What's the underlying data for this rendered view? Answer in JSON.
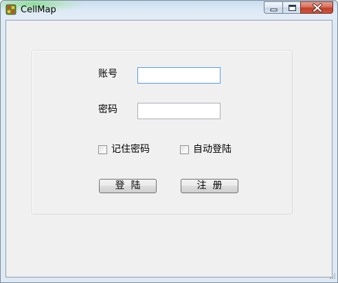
{
  "window": {
    "title": "CellMap"
  },
  "form": {
    "account_label": "账号",
    "account_value": "",
    "password_label": "密码",
    "password_value": "",
    "remember_label": "记住密码",
    "remember_checked": false,
    "autologin_label": "自动登陆",
    "autologin_checked": false,
    "login_button": "登  陆",
    "register_button": "注  册"
  },
  "icons": {
    "app": "cellmap-app-icon",
    "minimize": "minimize-icon",
    "maximize": "maximize-icon",
    "close": "close-icon"
  },
  "colors": {
    "close_button": "#c9462e",
    "focus_border": "#569de5",
    "client_background": "#f0f0f0"
  }
}
